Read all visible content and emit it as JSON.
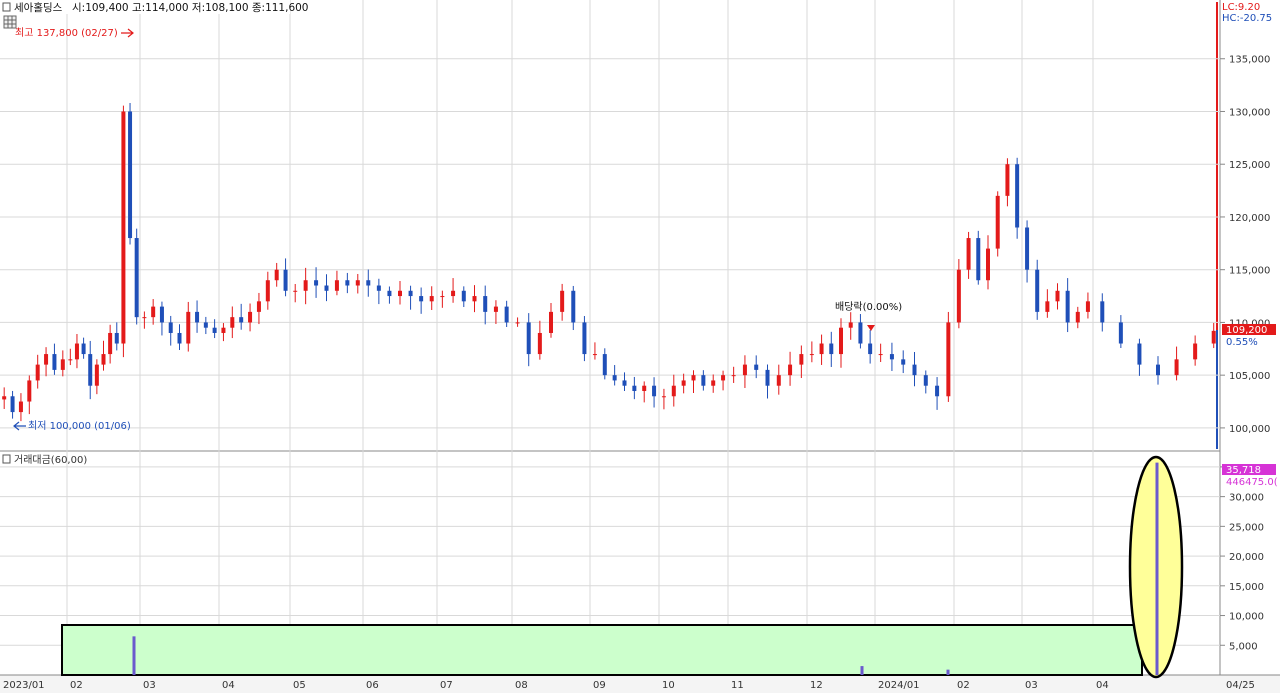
{
  "header": {
    "stock_name": "세아홀딩스",
    "ohlc_text": "시:109,400 고:114,000 저:108,100 종:111,600",
    "lc_text": "LC:9.20",
    "hc_text": "HC:-20.75"
  },
  "annotations": {
    "high_label": "최고 137,800 (02/27)",
    "low_label": "최저 100,000 (01/06)",
    "dividend_label": "배당락(0.00%)"
  },
  "price_badge": {
    "price": "109,200",
    "change": "0.55%"
  },
  "volume_panel": {
    "title": "거래대금(60,00)",
    "badge_value": "35,718",
    "badge_value2": "446475.0("
  },
  "colors": {
    "up": "#e31a1a",
    "down": "#1f4fb8",
    "highlight_box": "#ccffcc",
    "highlight_ellipse": "#ffff99",
    "volume_bar": "#6a5acd"
  },
  "chart_data": [
    {
      "type": "candlestick",
      "ylim": [
        98000,
        140000
      ],
      "y_ticks": [
        "100,000",
        "105,000",
        "110,000",
        "115,000",
        "120,000",
        "125,000",
        "130,000",
        "135,000"
      ],
      "x_labels": [
        "2023/01",
        "02",
        "03",
        "04",
        "05",
        "06",
        "07",
        "08",
        "09",
        "10",
        "11",
        "12",
        "2024/01",
        "02",
        "03",
        "04",
        "04/25"
      ],
      "series": [
        {
          "x": "2023/01",
          "close": [
            103000,
            101500,
            102500,
            104500,
            106000,
            107000,
            105500,
            106500
          ]
        },
        {
          "x": "02",
          "close": [
            106500,
            108000,
            107000,
            104000,
            106000,
            107000,
            109000,
            108000,
            130000,
            118000,
            110500
          ]
        },
        {
          "x": "03",
          "close": [
            110500,
            111500,
            110000,
            109000,
            108000,
            111000,
            110000,
            109500,
            109000
          ]
        },
        {
          "x": "04",
          "close": [
            109500,
            110500,
            110000,
            111000,
            112000,
            114000,
            115000,
            113000
          ]
        },
        {
          "x": "05",
          "close": [
            113000,
            114000,
            113500,
            113000,
            114000,
            113500,
            114000
          ]
        },
        {
          "x": "06",
          "close": [
            113500,
            113000,
            112500,
            113000,
            112500,
            112000,
            112500
          ]
        },
        {
          "x": "07",
          "close": [
            112500,
            113000,
            112000,
            112500,
            111000,
            111500,
            110000
          ]
        },
        {
          "x": "08",
          "close": [
            110000,
            107000,
            109000,
            111000,
            113000,
            110000,
            107000
          ]
        },
        {
          "x": "09",
          "close": [
            107000,
            105000,
            104500,
            104000,
            103500,
            104000,
            103000
          ]
        },
        {
          "x": "10",
          "close": [
            103000,
            104000,
            104500,
            105000,
            104000,
            104500,
            105000
          ]
        },
        {
          "x": "11",
          "close": [
            105000,
            106000,
            105500,
            104000,
            105000,
            106000,
            107000
          ]
        },
        {
          "x": "12",
          "close": [
            107000,
            108000,
            107000,
            109500,
            110000,
            108000,
            107000
          ]
        },
        {
          "x": "2024/01",
          "close": [
            107000,
            106500,
            106000,
            105000,
            104000,
            103000,
            110000
          ]
        },
        {
          "x": "02",
          "close": [
            115000,
            118000,
            114000,
            117000,
            122000,
            125000,
            119000
          ]
        },
        {
          "x": "03",
          "close": [
            115000,
            111000,
            112000,
            113000,
            110000,
            111000,
            112000
          ]
        },
        {
          "x": "04",
          "close": [
            110000,
            108000,
            106000,
            105000,
            106500,
            108000,
            109200
          ]
        }
      ]
    },
    {
      "type": "bar",
      "title": "거래대금(60,00)",
      "ylim": [
        0,
        37000
      ],
      "y_ticks": [
        "5,000",
        "10,000",
        "15,000",
        "20,000",
        "25,000",
        "30,000",
        "35,000"
      ],
      "values": [
        {
          "x": "02",
          "value": 6500
        },
        {
          "x": "12",
          "value": 1500
        },
        {
          "x": "2024/01",
          "value": 900
        },
        {
          "x": "04/25",
          "value": 35718
        }
      ]
    }
  ]
}
